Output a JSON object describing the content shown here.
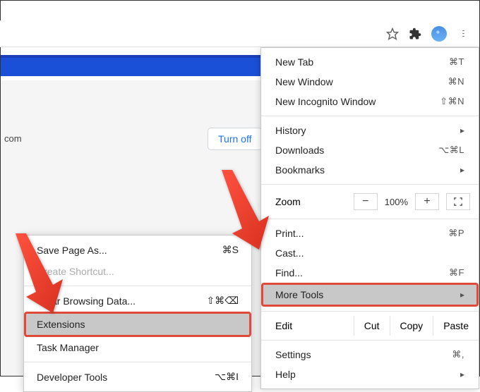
{
  "toolbar": {
    "star": "star-icon",
    "puzzle": "extensions-icon",
    "profile": "profile-avatar",
    "dots": "menu-icon"
  },
  "bluebar": "",
  "page": {
    "com": "com",
    "turnoff": "Turn off"
  },
  "menu": {
    "s1": [
      {
        "label": "New Tab",
        "shortcut": "⌘T"
      },
      {
        "label": "New Window",
        "shortcut": "⌘N"
      },
      {
        "label": "New Incognito Window",
        "shortcut": "⇧⌘N"
      }
    ],
    "s2": [
      {
        "label": "History",
        "chev": "▸"
      },
      {
        "label": "Downloads",
        "shortcut": "⌥⌘L"
      },
      {
        "label": "Bookmarks",
        "chev": "▸"
      }
    ],
    "zoom": {
      "label": "Zoom",
      "minus": "−",
      "pct": "100%",
      "plus": "+"
    },
    "s3": [
      {
        "label": "Print...",
        "shortcut": "⌘P"
      },
      {
        "label": "Cast..."
      },
      {
        "label": "Find...",
        "shortcut": "⌘F"
      },
      {
        "label": "More Tools",
        "chev": "▸",
        "hl": true
      }
    ],
    "edit": {
      "label": "Edit",
      "cut": "Cut",
      "copy": "Copy",
      "paste": "Paste"
    },
    "s4": [
      {
        "label": "Settings",
        "shortcut": "⌘,"
      },
      {
        "label": "Help",
        "chev": "▸"
      }
    ]
  },
  "submenu": {
    "s1": [
      {
        "label": "Save Page As...",
        "shortcut": "⌘S"
      },
      {
        "label": "Create Shortcut...",
        "disabled": true
      }
    ],
    "s2": [
      {
        "label": "Clear Browsing Data...",
        "shortcut": "⇧⌘⌫"
      },
      {
        "label": "Extensions",
        "hl": true
      },
      {
        "label": "Task Manager"
      }
    ],
    "s3": [
      {
        "label": "Developer Tools",
        "shortcut": "⌥⌘I"
      }
    ]
  }
}
